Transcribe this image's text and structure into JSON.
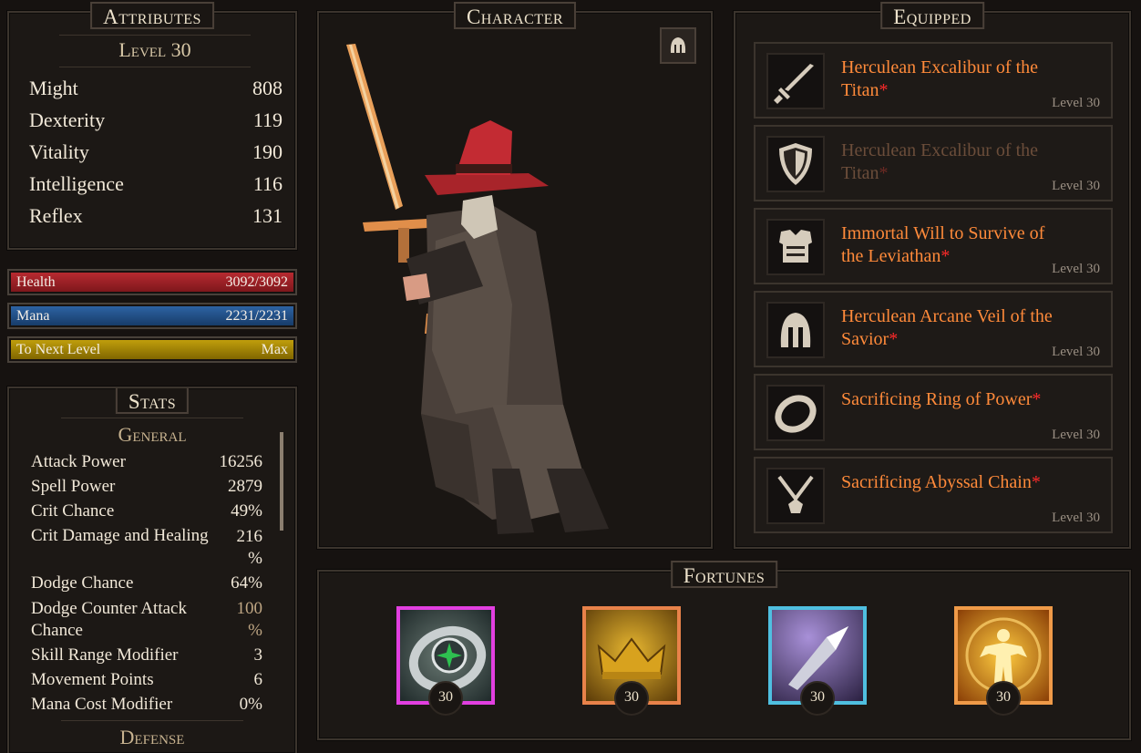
{
  "attributes": {
    "title": "Attributes",
    "level": "Level 30",
    "rows": [
      {
        "label": "Might",
        "value": "808"
      },
      {
        "label": "Dexterity",
        "value": "119"
      },
      {
        "label": "Vitality",
        "value": "190"
      },
      {
        "label": "Intelligence",
        "value": "116"
      },
      {
        "label": "Reflex",
        "value": "131"
      }
    ]
  },
  "bars": {
    "health": {
      "label": "Health",
      "value": "3092/3092",
      "fill": 1.0,
      "color": "#9a1e24"
    },
    "mana": {
      "label": "Mana",
      "value": "2231/2231",
      "fill": 1.0,
      "color": "#1f4f86"
    },
    "xp": {
      "label": "To Next Level",
      "value": "Max",
      "fill": 1.0,
      "color": "#a38706"
    }
  },
  "stats": {
    "title": "Stats",
    "general_heading": "General",
    "rows": [
      {
        "label": "Attack Power",
        "value": "16256"
      },
      {
        "label": "Spell Power",
        "value": "2879"
      },
      {
        "label": "Crit Chance",
        "value": "49%"
      },
      {
        "label": "Crit Damage and Healing",
        "value": "216 %"
      },
      {
        "label": "Dodge Chance",
        "value": "64%"
      },
      {
        "label": "Dodge Counter Attack Chance",
        "value": "100 %"
      },
      {
        "label": "Skill Range Modifier",
        "value": "3"
      },
      {
        "label": "Movement Points",
        "value": "6"
      },
      {
        "label": "Mana Cost Modifier",
        "value": "0%"
      }
    ],
    "defense_heading": "Defense"
  },
  "character": {
    "title": "Character",
    "helmet_toggle_icon": "helmet-icon"
  },
  "equipped": {
    "title": "Equipped",
    "items": [
      {
        "name": "Herculean Excalibur of the Titan",
        "mark": "*",
        "level": "Level 30",
        "icon": "sword-icon",
        "faded": false
      },
      {
        "name": "Herculean Excalibur of the Titan",
        "mark": "*",
        "level": "Level 30",
        "icon": "shield-icon",
        "faded": true
      },
      {
        "name": "Immortal Will to Survive of the Leviathan",
        "mark": "*",
        "level": "Level 30",
        "icon": "armor-icon",
        "faded": false
      },
      {
        "name": "Herculean Arcane Veil of the Savior",
        "mark": "*",
        "level": "Level 30",
        "icon": "helmet-icon",
        "faded": false
      },
      {
        "name": "Sacrificing Ring of Power",
        "mark": "*",
        "level": "Level 30",
        "icon": "ring-icon",
        "faded": false
      },
      {
        "name": "Sacrificing Abyssal Chain",
        "mark": "*",
        "level": "Level 30",
        "icon": "amulet-icon",
        "faded": false
      }
    ]
  },
  "fortunes": {
    "title": "Fortunes",
    "items": [
      {
        "level": "30",
        "border": "#e23fe0",
        "icon": "compass-ring-icon"
      },
      {
        "level": "30",
        "border": "#e8824a",
        "icon": "crown-icon"
      },
      {
        "level": "30",
        "border": "#4fbfe0",
        "icon": "crystal-blade-icon"
      },
      {
        "level": "30",
        "border": "#ef9a48",
        "icon": "radiant-figure-icon"
      }
    ]
  }
}
